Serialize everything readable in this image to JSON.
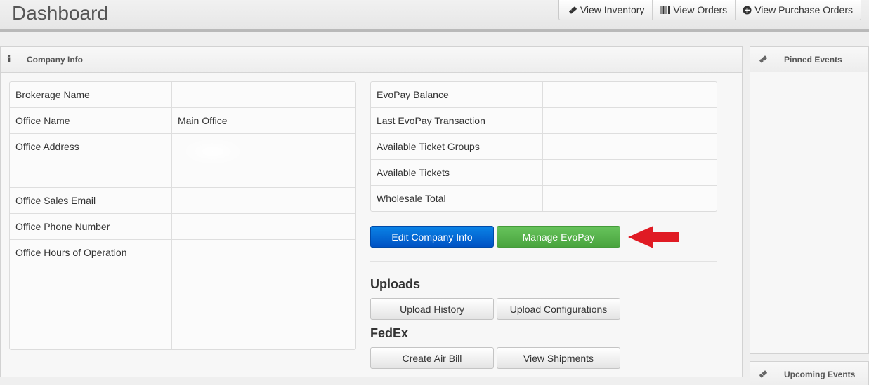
{
  "header": {
    "title": "Dashboard",
    "buttons": [
      {
        "label": "View Inventory",
        "icon": "ticket-icon"
      },
      {
        "label": "View Orders",
        "icon": "barcode-icon"
      },
      {
        "label": "View Purchase Orders",
        "icon": "plus-circle-icon"
      }
    ]
  },
  "company_box": {
    "title": "Company Info",
    "icon": "info-icon"
  },
  "left_table": [
    {
      "label": "Brokerage Name",
      "value": ""
    },
    {
      "label": "Office Name",
      "value": "Main Office"
    },
    {
      "label": "Office Address",
      "value": ""
    },
    {
      "label": "Office Sales Email",
      "value": ""
    },
    {
      "label": "Office Phone Number",
      "value": ""
    },
    {
      "label": "Office Hours of Operation",
      "value": ""
    }
  ],
  "right_table": [
    {
      "label": "EvoPay Balance",
      "value": ""
    },
    {
      "label": "Last EvoPay Transaction",
      "value": ""
    },
    {
      "label": "Available Ticket Groups",
      "value": ""
    },
    {
      "label": "Available Tickets",
      "value": ""
    },
    {
      "label": "Wholesale Total",
      "value": ""
    }
  ],
  "actions": {
    "edit_company": "Edit Company Info",
    "manage_evopay": "Manage EvoPay"
  },
  "uploads": {
    "title": "Uploads",
    "history": "Upload History",
    "configurations": "Upload Configurations"
  },
  "fedex": {
    "title": "FedEx",
    "create_air_bill": "Create Air Bill",
    "view_shipments": "View Shipments"
  },
  "pinned_events": {
    "title": "Pinned Events",
    "icon": "ticket-icon"
  },
  "upcoming_events": {
    "title": "Upcoming Events",
    "icon": "ticket-icon"
  },
  "colors": {
    "primary_blue": "#0066d6",
    "success_green": "#5cb450",
    "annotation_arrow": "#e01b24"
  }
}
